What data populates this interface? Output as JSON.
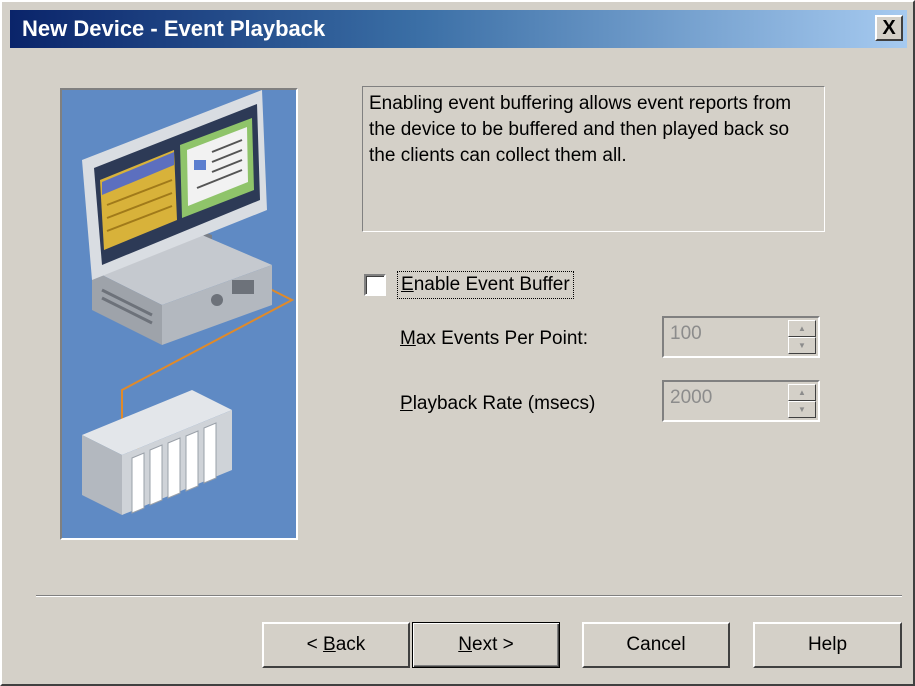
{
  "window": {
    "title": "New Device - Event Playback",
    "close_label": "X"
  },
  "description": "Enabling event buffering allows event reports from the device to be buffered and then played back so the clients can collect them all.",
  "enable_buffer": {
    "label_mnemonic": "E",
    "label_rest": "nable Event Buffer",
    "checked": false
  },
  "max_events": {
    "label_mnemonic": "M",
    "label_rest": "ax Events Per Point:",
    "value": "100",
    "disabled": true
  },
  "playback_rate": {
    "label_mnemonic": "P",
    "label_rest": "layback Rate (msecs)",
    "value": "2000",
    "disabled": true
  },
  "buttons": {
    "back_prefix": "< ",
    "back_mnemonic": "B",
    "back_rest": "ack",
    "next_mnemonic": "N",
    "next_rest": "ext >",
    "cancel": "Cancel",
    "help": "Help"
  },
  "colors": {
    "title_start": "#0a246a",
    "title_end": "#a6caf0",
    "face": "#d4d0c8",
    "illustration_bg": "#5f8ac4",
    "disabled_text": "#8c8c8c"
  },
  "icons": {
    "close": "close-icon",
    "spin_up": "spin-up-icon",
    "spin_down": "spin-down-icon"
  }
}
